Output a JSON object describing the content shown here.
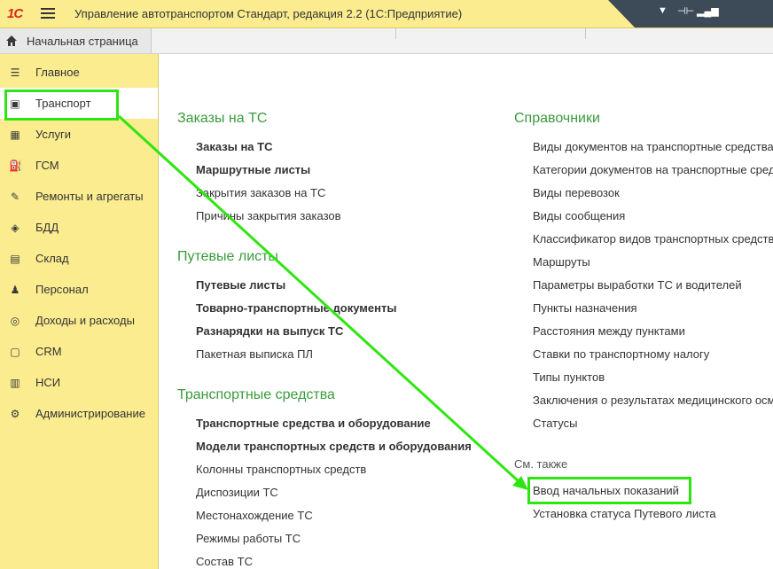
{
  "app": {
    "logo": "1С",
    "title": "Управление автотранспортом Стандарт, редакция 2.2  (1С:Предприятие)"
  },
  "home_tab": {
    "label": "Начальная страница"
  },
  "sidebar": {
    "items": [
      {
        "label": "Главное",
        "icon": "menu-lines-icon"
      },
      {
        "label": "Транспорт",
        "icon": "bus-icon",
        "active": true
      },
      {
        "label": "Услуги",
        "icon": "calculator-icon"
      },
      {
        "label": "ГСМ",
        "icon": "fuel-icon"
      },
      {
        "label": "Ремонты и агрегаты",
        "icon": "wrench-icon"
      },
      {
        "label": "БДД",
        "icon": "road-sign-icon"
      },
      {
        "label": "Склад",
        "icon": "boxes-icon"
      },
      {
        "label": "Персонал",
        "icon": "person-icon"
      },
      {
        "label": "Доходы и расходы",
        "icon": "coins-icon"
      },
      {
        "label": "CRM",
        "icon": "contact-card-icon"
      },
      {
        "label": "НСИ",
        "icon": "books-icon"
      },
      {
        "label": "Администрирование",
        "icon": "gear-icon"
      }
    ]
  },
  "sections": {
    "orders": {
      "title": "Заказы на ТС",
      "links": [
        "Заказы на ТС",
        "Маршрутные листы",
        "Закрытия заказов на ТС",
        "Причины закрытия заказов"
      ]
    },
    "waybills": {
      "title": "Путевые листы",
      "links": [
        "Путевые листы",
        "Товарно-транспортные документы",
        "Разнарядки на выпуск ТС",
        "Пакетная выписка ПЛ"
      ]
    },
    "vehicles": {
      "title": "Транспортные средства",
      "links": [
        "Транспортные средства и оборудование",
        "Модели транспортных средств и оборудования",
        "Колонны транспортных средств",
        "Диспозиции ТС",
        "Местонахождение ТС",
        "Режимы работы ТС",
        "Состав ТС"
      ]
    },
    "reference": {
      "title": "Справочники",
      "links": [
        "Виды документов на транспортные средства",
        "Категории документов на транспортные средства",
        "Виды перевозок",
        "Виды сообщения",
        "Классификатор видов транспортных средств",
        "Маршруты",
        "Параметры выработки ТС и водителей",
        "Пункты назначения",
        "Расстояния между пунктами",
        "Ставки по транспортному налогу",
        "Типы пунктов",
        "Заключения о результатах медицинского осмотра",
        "Статусы"
      ]
    },
    "see_also": {
      "title": "См. также",
      "links": [
        "Ввод начальных показаний",
        "Установка статуса Путевого листа"
      ]
    }
  },
  "colors": {
    "sidebar_bg": "#fbec8f",
    "section_title": "#3a9a3c",
    "highlight": "#2ee60f",
    "titlebar_dark": "#3d4a57"
  }
}
